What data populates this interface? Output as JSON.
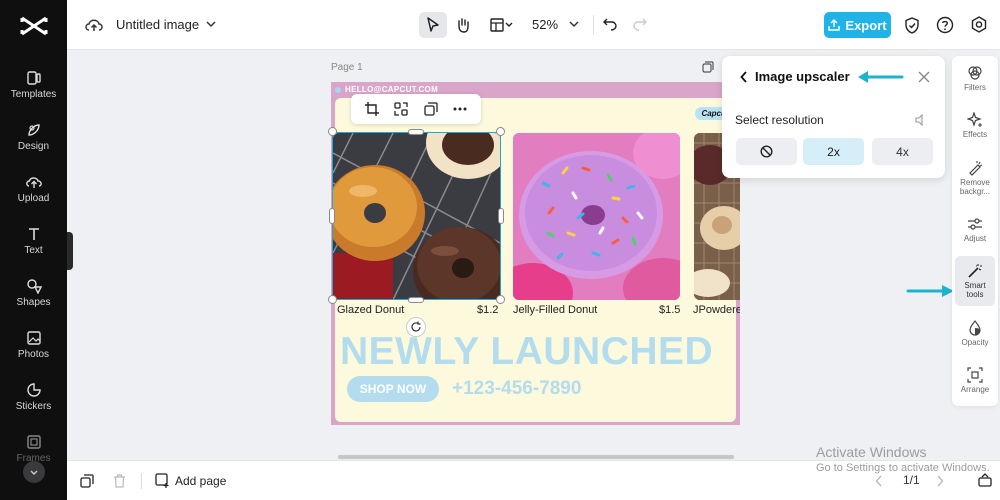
{
  "sidebar": {
    "items": [
      {
        "label": "Templates",
        "icon": "templates-icon"
      },
      {
        "label": "Design",
        "icon": "design-icon"
      },
      {
        "label": "Upload",
        "icon": "upload-icon"
      },
      {
        "label": "Text",
        "icon": "text-icon"
      },
      {
        "label": "Shapes",
        "icon": "shapes-icon"
      },
      {
        "label": "Photos",
        "icon": "photos-icon"
      },
      {
        "label": "Stickers",
        "icon": "stickers-icon"
      },
      {
        "label": "Frames",
        "icon": "frames-icon"
      }
    ]
  },
  "topbar": {
    "title": "Untitled image",
    "zoom": "52%",
    "export_label": "Export"
  },
  "canvas": {
    "page_label": "Page 1",
    "design": {
      "hello": "HELLO@CAPCUT.COM",
      "brand": "Capcut",
      "products": [
        {
          "name": "Glazed Donut",
          "price": "$1.2"
        },
        {
          "name": "Jelly-Filled Donut",
          "price": "$1.5"
        },
        {
          "name": "JPowdere",
          "price": ""
        }
      ],
      "headline": "NEWLY LAUNCHED",
      "shop_now": "SHOP NOW",
      "phone": "+123-456-7890"
    }
  },
  "upscaler": {
    "title": "Image upscaler",
    "subtitle": "Select resolution",
    "options": [
      "2x",
      "4x"
    ],
    "selected": "2x"
  },
  "right_toolbar": {
    "items": [
      {
        "label": "Filters"
      },
      {
        "label": "Effects"
      },
      {
        "label": "Remove backgr..."
      },
      {
        "label": "Adjust"
      },
      {
        "label": "Smart tools"
      },
      {
        "label": "Opacity"
      },
      {
        "label": "Arrange"
      }
    ]
  },
  "bottom": {
    "add_page": "Add page",
    "page_count": "1/1"
  },
  "watermark": {
    "line1": "Activate Windows",
    "line2": "Go to Settings to activate Windows."
  },
  "colors": {
    "accent": "#1fb3e8",
    "sidebar_bg": "#0f0f10",
    "design_pink": "#d9a5c8",
    "design_cream": "#fdf9dc",
    "headline_blue": "#b3dcee"
  }
}
